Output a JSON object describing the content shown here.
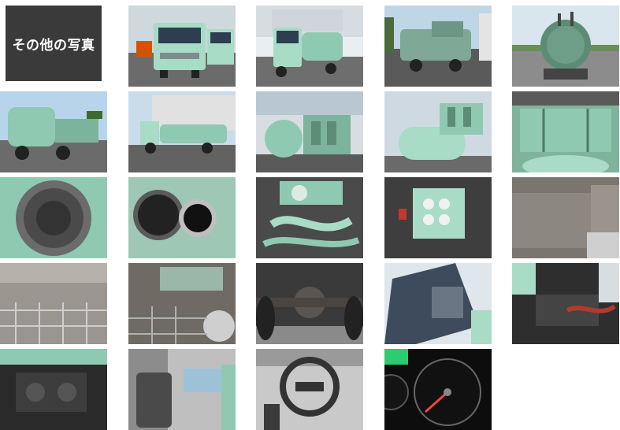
{
  "heading": {
    "text": "その他の写真"
  },
  "photos": [
    {
      "icon": "truck-front-photo"
    },
    {
      "icon": "truck-front-angle-photo"
    },
    {
      "icon": "truck-rear-angle-photo"
    },
    {
      "icon": "tank-rear-photo"
    },
    {
      "icon": "truck-side-left-photo"
    },
    {
      "icon": "truck-side-full-photo"
    },
    {
      "icon": "vacuum-pump-photo"
    },
    {
      "icon": "tank-side-photo"
    },
    {
      "icon": "tank-top-photo"
    },
    {
      "icon": "tank-interior-photo"
    },
    {
      "icon": "tank-hatch-photo"
    },
    {
      "icon": "pump-piping-photo"
    },
    {
      "icon": "gauge-panel-photo"
    },
    {
      "icon": "frame-rail-photo"
    },
    {
      "icon": "cargo-basket-photo"
    },
    {
      "icon": "undercarriage-photo"
    },
    {
      "icon": "rear-axle-photo"
    },
    {
      "icon": "cab-tilted-photo"
    },
    {
      "icon": "engine-bay-photo"
    },
    {
      "icon": "engine-detail-photo"
    },
    {
      "icon": "driver-seat-photo"
    },
    {
      "icon": "steering-wheel-photo"
    },
    {
      "icon": "speedometer-photo"
    }
  ]
}
